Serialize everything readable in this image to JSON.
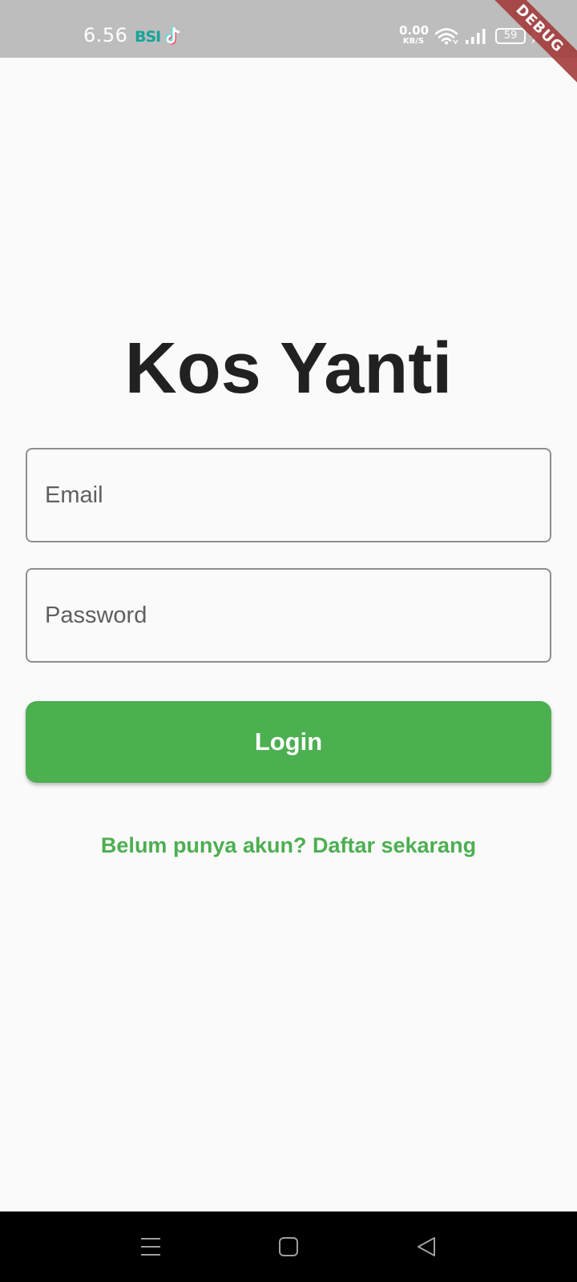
{
  "status_bar": {
    "time": "6.56",
    "app_icon_label": "BSI",
    "net_speed_value": "0.00",
    "net_speed_unit": "KB/S",
    "battery_level": "59",
    "icons": [
      "bsi-icon",
      "tiktok-icon",
      "wifi-icon",
      "signal-icon",
      "battery-icon",
      "charging-bolt-icon"
    ]
  },
  "debug_banner": "DEBUG",
  "login": {
    "title": "Kos Yanti",
    "email_placeholder": "Email",
    "password_placeholder": "Password",
    "login_button": "Login",
    "register_link": "Belum punya akun? Daftar sekarang"
  },
  "nav_bar": {
    "icons": [
      "menu-icon",
      "home-icon",
      "back-icon"
    ]
  },
  "colors": {
    "primary_green": "#4caf50",
    "status_bar": "#bdbdbd",
    "background": "#fafafa",
    "title_text": "#212121",
    "debug_ribbon": "#a43c3c"
  }
}
